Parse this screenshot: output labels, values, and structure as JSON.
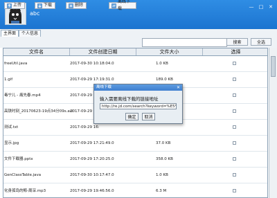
{
  "user": {
    "name": "abc"
  },
  "tabs": [
    "主界面",
    "个人信息"
  ],
  "toolbar": {
    "upload": "上传",
    "download": "下载",
    "delete": "删除",
    "offline": "离线下载"
  },
  "search": {
    "value": "",
    "search_label": "搜索",
    "select_all_label": "全选"
  },
  "columns": [
    "文件名",
    "文件创建日期",
    "文件大小",
    "选择"
  ],
  "rows": [
    {
      "name": "freeUtil.java",
      "date": "2017-09-30 10:18:04.0",
      "size": "1.0 KB"
    },
    {
      "name": "1.gif",
      "date": "2017-09-29 17:19:31.0",
      "size": "189.0 KB"
    },
    {
      "name": "毒宁儿 - 痛先春.mp4",
      "date": "2017-09-29 20:",
      "size": ""
    },
    {
      "name": "高铁时刻_20170623-19点34分09s.avi",
      "date": "2017-09-29 20:",
      "size": ""
    },
    {
      "name": "测试.txt",
      "date": "2017-09-29 16:",
      "size": ""
    },
    {
      "name": "显示.jpg",
      "date": "2017-09-29 17:21:49.0",
      "size": "37.0 KB"
    },
    {
      "name": "文件下载器.pptx",
      "date": "2017-09-29 17:20:25.0",
      "size": "358.0 KB"
    },
    {
      "name": "GenClassTable.java",
      "date": "2017-09-30 10:17:47.0",
      "size": "1.0 KB"
    },
    {
      "name": "化身孤岛的鲸-周深.mp3",
      "date": "2017-09-29 19:46:56.0",
      "size": "6.3 M"
    }
  ],
  "dialog": {
    "title": "离线下载",
    "prompt": "输入需要离线下载的链接地址",
    "url": "http://re.jd.com/search?keyword=%E5%8A%",
    "ok": "确定",
    "cancel": "取消"
  }
}
